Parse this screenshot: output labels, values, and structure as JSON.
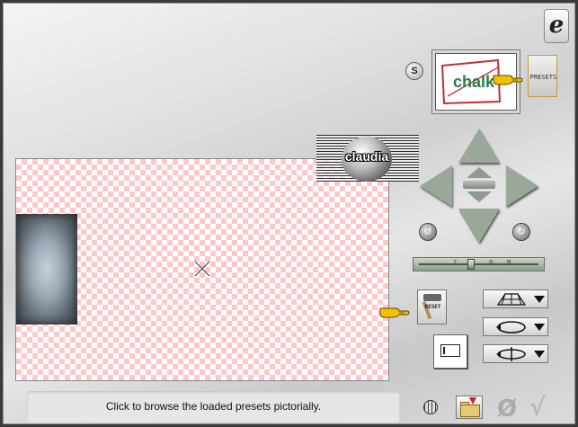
{
  "logo": {
    "glyph": "e"
  },
  "toolbar": {
    "s_label": "S",
    "presets_label": "PRESETS",
    "reset_label": "RESET"
  },
  "preset_preview": {
    "text": "chalk"
  },
  "watermark": {
    "text": "claudia"
  },
  "zoom": {
    "ticks": [
      "2",
      "0",
      "M"
    ],
    "level": 0.45
  },
  "rotate_buttons": {
    "left_glyph": "↺",
    "right_glyph": "↻"
  },
  "status": {
    "message": "Click to browse the loaded presets pictorially."
  },
  "bottom": {
    "cancel_glyph": "Ø",
    "ok_glyph": "√"
  },
  "colors": {
    "checker": "#ffc8c8",
    "arrows": "#9aa89a",
    "pointer": "#f2c200"
  },
  "icons": [
    "grid-icon",
    "open-folder-icon",
    "cancel-icon",
    "ok-checkmark-icon",
    "hand-pointer-icon",
    "hammer-icon",
    "frame-icon"
  ]
}
